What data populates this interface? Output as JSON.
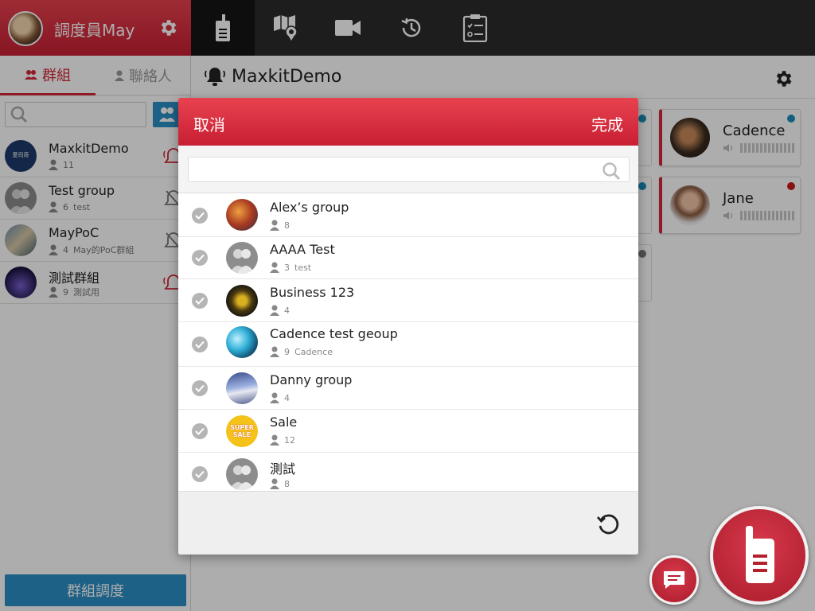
{
  "user": {
    "name": "調度員May"
  },
  "colors": {
    "brand_red": "#d3283a",
    "accent_blue": "#2b8fc6",
    "topbar": "#2b2b2b"
  },
  "top_nav": [
    {
      "icon": "walkie-talkie-icon",
      "active": true
    },
    {
      "icon": "map-location-icon",
      "active": false
    },
    {
      "icon": "video-camera-icon",
      "active": false
    },
    {
      "icon": "history-icon",
      "active": false
    },
    {
      "icon": "checklist-icon",
      "active": false
    }
  ],
  "sidebar": {
    "tabs": [
      {
        "label": "群組",
        "icon": "group-icon"
      },
      {
        "label": "聯絡人",
        "icon": "person-icon"
      }
    ],
    "groups": [
      {
        "name": "MaxkitDemo",
        "count": "11",
        "note": "",
        "bell": "ringing"
      },
      {
        "name": "Test group",
        "count": "6",
        "note": "test",
        "bell": "muted"
      },
      {
        "name": "MayPoC",
        "count": "4",
        "note": "May的PoC群組",
        "bell": "muted"
      },
      {
        "name": "測試群組",
        "count": "9",
        "note": "測試用",
        "bell": "ringing"
      }
    ],
    "dispatch_label": "群組調度"
  },
  "main": {
    "title": "MaxkitDemo",
    "members": [
      {
        "name": "Cadence",
        "status_color": "#1a8fb8"
      },
      {
        "name": "Jane",
        "status_color": "#cc1a1a"
      }
    ],
    "partial_status_colors": [
      "#1a8fb8",
      "#1a8fb8",
      "#777777"
    ]
  },
  "modal": {
    "cancel_label": "取消",
    "done_label": "完成",
    "search_value": "",
    "search_placeholder": "",
    "groups": [
      {
        "name": "Alex’s group",
        "count": "8",
        "note": ""
      },
      {
        "name": "AAAA Test",
        "count": "3",
        "note": "test"
      },
      {
        "name": "Business 123",
        "count": "4",
        "note": ""
      },
      {
        "name": "Cadence test geoup",
        "count": "9",
        "note": "Cadence"
      },
      {
        "name": "Danny group",
        "count": "4",
        "note": ""
      },
      {
        "name": "Sale",
        "count": "12",
        "note": "",
        "avatar_text": [
          "SUPER",
          "SALE"
        ]
      },
      {
        "name": "測試",
        "count": "8",
        "note": ""
      }
    ]
  }
}
